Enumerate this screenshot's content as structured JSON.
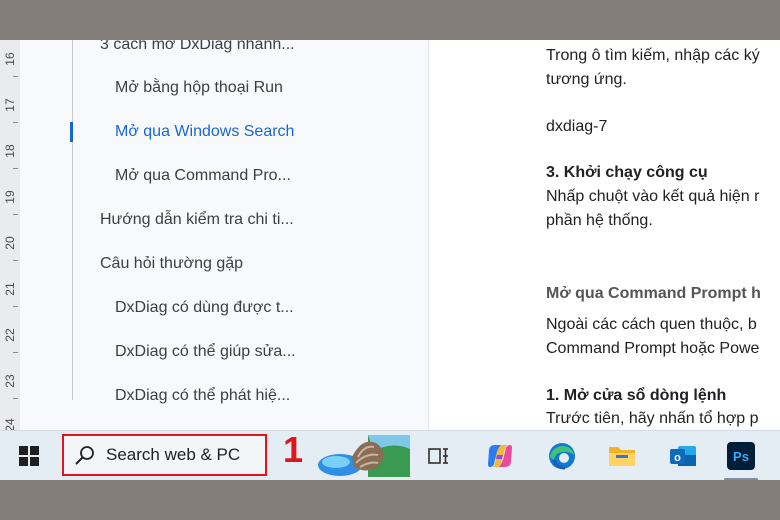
{
  "ruler": {
    "numbers": [
      "16",
      "17",
      "18",
      "19",
      "20",
      "21",
      "22",
      "23",
      "24"
    ]
  },
  "outline": {
    "items": [
      {
        "label": "3 cách mở DxDiag nhanh...",
        "level": 1
      },
      {
        "label": "Mở bằng hộp thoại Run",
        "level": 2
      },
      {
        "label": "Mở qua Windows Search",
        "level": 2,
        "active": true
      },
      {
        "label": "Mở qua Command Pro...",
        "level": 2
      },
      {
        "label": "Hướng dẫn kiểm tra chi ti...",
        "level": 1
      },
      {
        "label": "Câu hỏi thường gặp",
        "level": 1
      },
      {
        "label": "DxDiag có dùng được t...",
        "level": 2
      },
      {
        "label": "DxDiag có thể giúp sửa...",
        "level": 2
      },
      {
        "label": "DxDiag có thể phát hiệ...",
        "level": 2
      }
    ]
  },
  "document": {
    "lines": [
      {
        "text": "Trong ô tìm kiếm, nhập các ký",
        "style": "normal"
      },
      {
        "text": "tương ứng.",
        "style": "normal"
      },
      {
        "text": "dxdiag-7",
        "style": "normal"
      },
      {
        "text": "3. Khởi chạy công cụ",
        "style": "bold"
      },
      {
        "text": "Nhấp chuột vào kết quả hiện r",
        "style": "normal"
      },
      {
        "text": "phần hệ thống.",
        "style": "normal"
      },
      {
        "text": "Mở qua Command Prompt h",
        "style": "sub"
      },
      {
        "text": "Ngoài các cách quen thuộc, b",
        "style": "normal"
      },
      {
        "text": "Command Prompt hoặc Powe",
        "style": "normal"
      },
      {
        "text": "1. Mở cửa sổ dòng lệnh",
        "style": "bold"
      },
      {
        "text": "Trước tiên, hãy nhấn tổ hợp p",
        "style": "normal"
      }
    ]
  },
  "taskbar": {
    "search_label": "Search web & PC",
    "annotation_number": "1",
    "accent_color": "#e0151b",
    "icons": [
      "windows-start-icon",
      "search-icon",
      "widgets-icon",
      "task-view-icon",
      "copilot-icon",
      "edge-icon",
      "file-explorer-icon",
      "outlook-icon",
      "photoshop-icon"
    ],
    "photoshop_label": "Ps",
    "outlook_label": "o"
  }
}
